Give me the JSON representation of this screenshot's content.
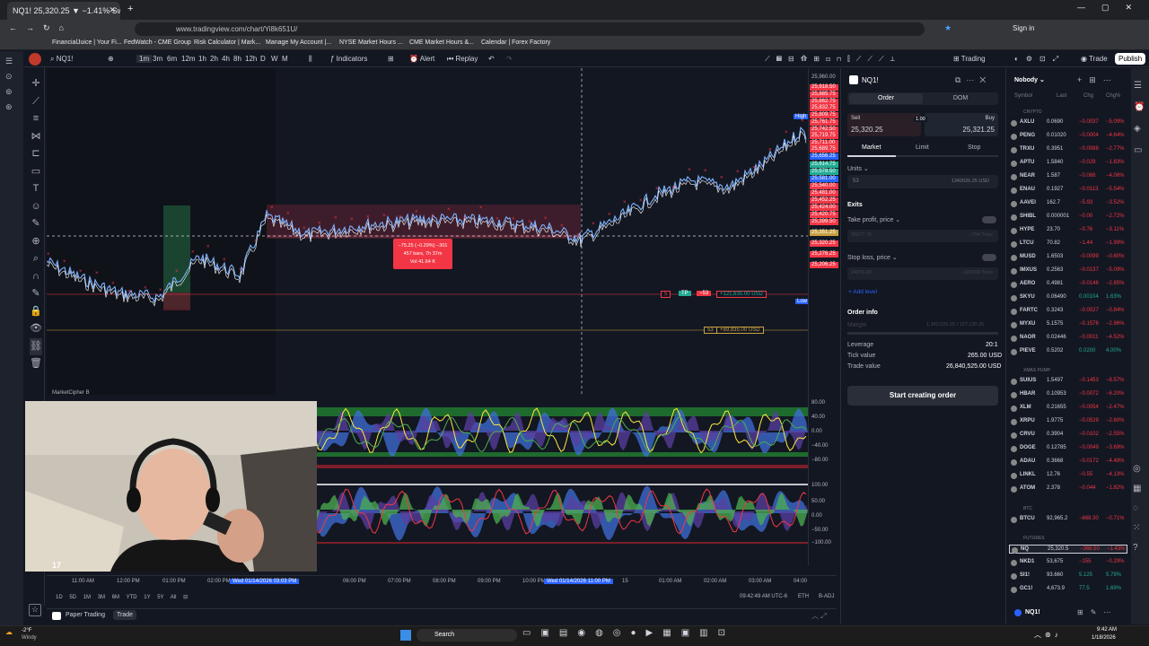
{
  "browser": {
    "tab_title": "NQ1! 25,320.25 ▼ −1.41% Swi",
    "url": "www.tradingview.com/chart/Yi8k651U/",
    "profile": "Sign in",
    "bookmarks": [
      "FinancialJuice | Your Fi...",
      "FedWatch - CME Group",
      "Risk Calculator | Mark...",
      "Manage My Account |...",
      "NYSE Market Hours ...",
      "CME Market Hours &...",
      "Calendar | Forex Factory"
    ]
  },
  "toolbar": {
    "symbol": "NQ1!",
    "timeframes": [
      "1m",
      "3m",
      "6m",
      "12m",
      "1h",
      "2h",
      "4h",
      "8h",
      "12h",
      "D",
      "W",
      "M"
    ],
    "indicators": "Indicators",
    "alert": "Alert",
    "replay": "Replay",
    "trading": "Trading",
    "trade": "Trade",
    "publish": "Publish"
  },
  "chart": {
    "high_label": "High",
    "low_label": "Low",
    "measure_box": {
      "line1": "−75.25 (−0.29%) −301",
      "line2": "457 bars, 7h 37m",
      "line3": "Vol 41.64 K"
    },
    "tp_label": "TP",
    "position_qty": "−53",
    "tp_value": "+121,635.00 USD",
    "sl_qty": "53",
    "sl_value": "+89,835.00 USD",
    "indicator_name": "MarketCipher B",
    "price_labels": [
      "25,960.00",
      "25,918.50",
      "25,885.75",
      "25,862.75",
      "25,832.75",
      "25,809.75",
      "25,761.75",
      "25,742.50",
      "25,719.75",
      "25,711.00",
      "25,689.75",
      "25,656.25",
      "25,614.75",
      "25,578.50",
      "25,581.00",
      "25,540.00",
      "25,481.00",
      "25,452.25",
      "25,424.00",
      "25,420.75",
      "25,399.50",
      "25,351.25",
      "25,320.25",
      "25,276.25",
      "25,206.25"
    ],
    "osc_labels_top": [
      "80.00",
      "40.00",
      "0.00",
      "−40.00",
      "−80.00"
    ],
    "osc_labels_bottom": [
      "100.00",
      "50.00",
      "0.00",
      "−50.00",
      "−100.00"
    ],
    "time_labels": [
      "11:00 AM",
      "12:00 PM",
      "01:00 PM",
      "02:00 PM",
      "06:00 PM",
      "07:00 PM",
      "08:00 PM",
      "09:00 PM",
      "10:00 PM",
      "15",
      "01:00 AM",
      "02:00 AM",
      "03:00 AM",
      "04:00"
    ],
    "time_highlight_1": "Wed 01/14/2026   03:03 PM",
    "time_highlight_2": "Wed 01/14/2026   11:00 PM",
    "clock": "09:42:49 AM UTC-6",
    "eth": "ETH",
    "badj": "B-ADJ",
    "ranges": [
      "1D",
      "5D",
      "1M",
      "3M",
      "6M",
      "YTD",
      "1Y",
      "5Y",
      "All"
    ]
  },
  "paper": {
    "label": "Paper Trading",
    "trade": "Trade"
  },
  "order_panel": {
    "symbol": "NQ1!",
    "tab_order": "Order",
    "tab_dom": "DOM",
    "sell_label": "Sell",
    "sell_price": "25,320.25",
    "buy_label": "Buy",
    "buy_price": "25,321.25",
    "spread": "1.00",
    "types": [
      "Market",
      "Limit",
      "Stop"
    ],
    "units_label": "Units",
    "units_value": "53",
    "units_usd": "1342026.25 USD",
    "exits": "Exits",
    "take_profit": "Take profit, price",
    "tp_placeholder": "25077.75",
    "tp_ticks": "−794 Ticks",
    "stop_loss": "Stop loss, price",
    "sl_placeholder": "24976.00",
    "sl_ticks": "−126399 Ticks",
    "add_level": "+ Add level",
    "order_info": "Order info",
    "margin": "Margin",
    "margin_value": "1,342,026.25 / 137,130.25",
    "leverage": "Leverage",
    "leverage_value": "20:1",
    "tick_value": "Tick value",
    "tick_value_v": "265.00 USD",
    "trade_value": "Trade value",
    "trade_value_v": "26,840,525.00 USD",
    "cta": "Start creating order"
  },
  "watchlist": {
    "name": "Nobody",
    "headers": [
      "Symbol",
      "Last",
      "Chg",
      "Chg%"
    ],
    "sections": [
      "CRYPTO",
      "XMAS PUMP",
      "BTC",
      "FUTURES"
    ],
    "crypto": [
      {
        "s": "AXLU",
        "l": "0.0690",
        "c": "−0.0037",
        "p": "−5.09%",
        "d": "neg"
      },
      {
        "s": "PENG",
        "l": "0.01020",
        "c": "−0.0004",
        "p": "−4.64%",
        "d": "neg"
      },
      {
        "s": "TRXU",
        "l": "0.3951",
        "c": "−0.0088",
        "p": "−2.77%",
        "d": "neg"
      },
      {
        "s": "APTU",
        "l": "1.5840",
        "c": "−0.029",
        "p": "−1.83%",
        "d": "neg"
      },
      {
        "s": "NEAR",
        "l": "1.587",
        "c": "−0.066",
        "p": "−4.06%",
        "d": "neg"
      },
      {
        "s": "ENAU",
        "l": "0.1927",
        "c": "−0.0113",
        "p": "−5.54%",
        "d": "neg"
      },
      {
        "s": "AAVEI",
        "l": "162.7",
        "c": "−5.93",
        "p": "−3.52%",
        "d": "neg"
      },
      {
        "s": "SHIBL",
        "l": "0.000001",
        "c": "−0.00",
        "p": "−2.72%",
        "d": "neg"
      },
      {
        "s": "HYPE",
        "l": "23.70",
        "c": "−0.76",
        "p": "−3.11%",
        "d": "neg"
      },
      {
        "s": "LTCU",
        "l": "70.82",
        "c": "−1.44",
        "p": "−1.99%",
        "d": "neg"
      },
      {
        "s": "MUSD",
        "l": "1.6503",
        "c": "−0.0099",
        "p": "−0.60%",
        "d": "neg"
      },
      {
        "s": "IMXUS",
        "l": "0.2563",
        "c": "−0.0137",
        "p": "−5.09%",
        "d": "neg"
      },
      {
        "s": "AERO",
        "l": "0.4981",
        "c": "−0.0146",
        "p": "−2.85%",
        "d": "neg"
      },
      {
        "s": "SKYU",
        "l": "0.06490",
        "c": "0.00104",
        "p": "1.63%",
        "d": "pos"
      },
      {
        "s": "FARTC",
        "l": "0.3243",
        "c": "−0.0027",
        "p": "−0.84%",
        "d": "neg"
      },
      {
        "s": "MYXU",
        "l": "5.1575",
        "c": "−0.1576",
        "p": "−2.96%",
        "d": "neg"
      },
      {
        "s": "NAOR",
        "l": "0.02446",
        "c": "−0.0011",
        "p": "−4.52%",
        "d": "neg"
      },
      {
        "s": "PIEVE",
        "l": "0.5202",
        "c": "0.0200",
        "p": "4.00%",
        "d": "pos"
      }
    ],
    "xmas": [
      {
        "s": "SUIUS",
        "l": "1.5497",
        "c": "−0.1453",
        "p": "−8.57%",
        "d": "neg"
      },
      {
        "s": "HBAR",
        "l": "0.10953",
        "c": "−0.0072",
        "p": "−6.20%",
        "d": "neg"
      },
      {
        "s": "XLM",
        "l": "0.21655",
        "c": "−0.0054",
        "p": "−2.47%",
        "d": "neg"
      },
      {
        "s": "XRPU",
        "l": "1.9775",
        "c": "−0.0529",
        "p": "−2.60%",
        "d": "neg"
      },
      {
        "s": "CRVU",
        "l": "0.3904",
        "c": "−0.0102",
        "p": "−2.55%",
        "d": "neg"
      },
      {
        "s": "DOGE",
        "l": "0.12785",
        "c": "−0.0049",
        "p": "−3.69%",
        "d": "neg"
      },
      {
        "s": "ADAU",
        "l": "0.3668",
        "c": "−0.0172",
        "p": "−4.48%",
        "d": "neg"
      },
      {
        "s": "LINKL",
        "l": "12.76",
        "c": "−0.55",
        "p": "−4.13%",
        "d": "neg"
      },
      {
        "s": "ATOM",
        "l": "2.378",
        "c": "−0.044",
        "p": "−1.82%",
        "d": "neg"
      }
    ],
    "btc": [
      {
        "s": "BTCU",
        "l": "92,965.2",
        "c": "−668.30",
        "p": "−0.71%",
        "d": "neg"
      }
    ],
    "futures": [
      {
        "s": "NQ",
        "l": "25,320.5",
        "c": "−368.50",
        "p": "−1.43%",
        "d": "neg"
      },
      {
        "s": "NKD1",
        "l": "53,675",
        "c": "−155",
        "p": "−0.29%",
        "d": "neg"
      },
      {
        "s": "SI1!",
        "l": "93.660",
        "c": "5.125",
        "p": "5.79%",
        "d": "pos"
      },
      {
        "s": "GC1!",
        "l": "4,673.9",
        "c": "77.5",
        "p": "1.69%",
        "d": "pos"
      }
    ],
    "footer_symbol": "NQ1!"
  },
  "taskbar": {
    "weather_temp": "-2°F",
    "weather_desc": "Windy",
    "search": "Search",
    "time": "9:42 AM",
    "date": "1/18/2026"
  },
  "colors": {
    "bg": "#131722",
    "red": "#f23645",
    "green": "#22ab94",
    "blue": "#2962ff"
  }
}
